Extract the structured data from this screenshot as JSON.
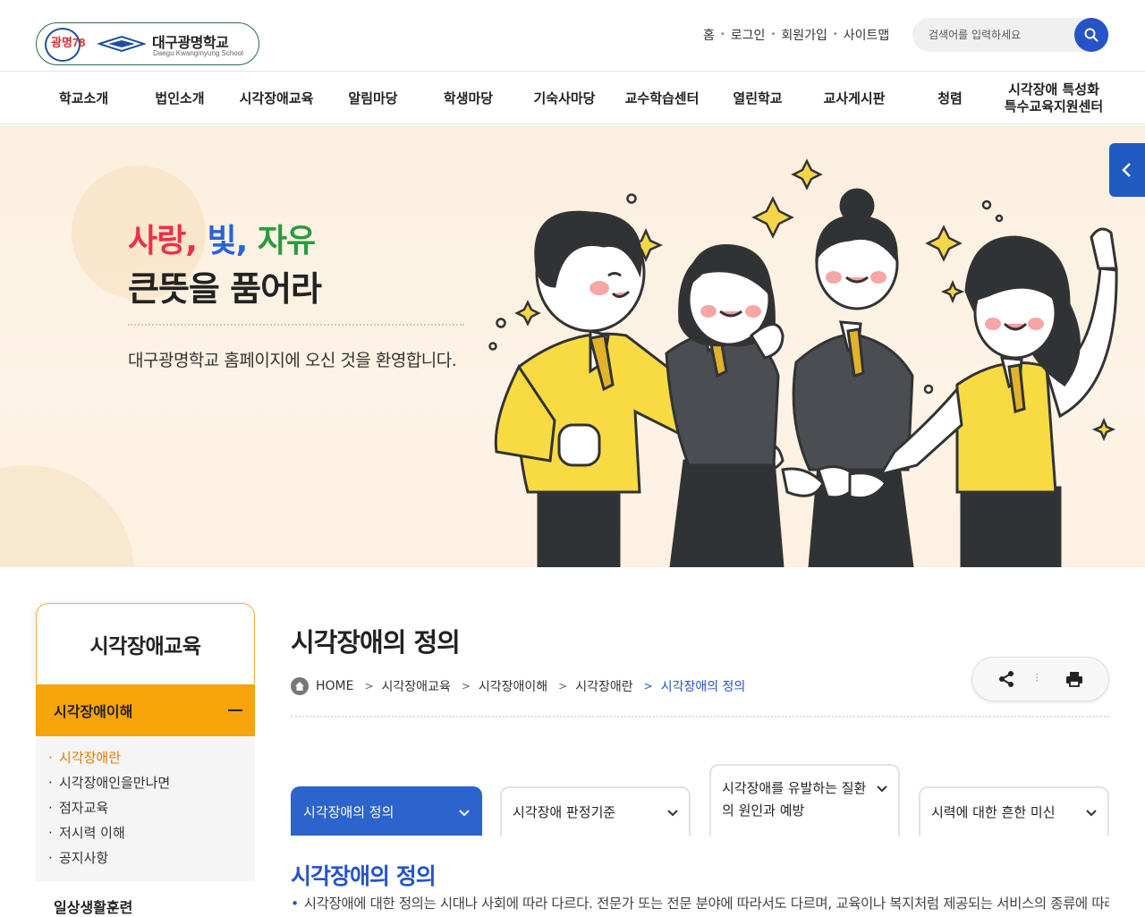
{
  "header": {
    "logo": {
      "badge": "광명78",
      "name_ko": "대구광명학교",
      "name_en": "Daegu Kwangmyung School"
    },
    "util_links": [
      "홈",
      "로그인",
      "회원가입",
      "사이트맵"
    ],
    "search": {
      "placeholder": "검색어를 입력하세요"
    }
  },
  "gnb": {
    "items": [
      "학교소개",
      "법인소개",
      "시각장애교육",
      "알림마당",
      "학생마당",
      "기숙사마당",
      "교수학습센터",
      "열린학교",
      "교사게시판",
      "청렴",
      "시각장애 특성화\n특수교육지원센터"
    ]
  },
  "hero": {
    "slogan": {
      "w1": "사랑",
      "comma1": ",",
      "w2": "빛",
      "comma2": ",",
      "w3": "자유"
    },
    "title": "큰뜻을 품어라",
    "welcome": "대구광명학교 홈페이지에 오신 것을 환영합니다."
  },
  "lnb": {
    "title": "시각장애교육",
    "active": "시각장애이해",
    "sub_items": [
      "시각장애란",
      "시각장애인을만나면",
      "점자교육",
      "저시력 이해",
      "공지사항"
    ],
    "next": "일상생활훈련"
  },
  "content": {
    "page_title": "시각장애의 정의",
    "breadcrumb": [
      "HOME",
      "시각장애교육",
      "시각장애이해",
      "시각장애란",
      "시각장애의 정의"
    ],
    "tabs": [
      "시각장애의 정의",
      "시각장애 판정기준",
      "시각장애를 유발하는 질환의 원인과 예방",
      "시력에 대한 흔한 미신"
    ],
    "section_title": "시각장애의 정의",
    "body": "시각장애에 대한 정의는 시대나 사회에 따라 다르다. 전문가 또는 전문 분야에 따라서도 다르며, 교육이나 복지처럼 제공되는 서비스의 종류에 따라"
  },
  "colors": {
    "primary_blue": "#2454c8",
    "accent_orange": "#f6a40a",
    "hero_bg": "#fbf0df"
  }
}
